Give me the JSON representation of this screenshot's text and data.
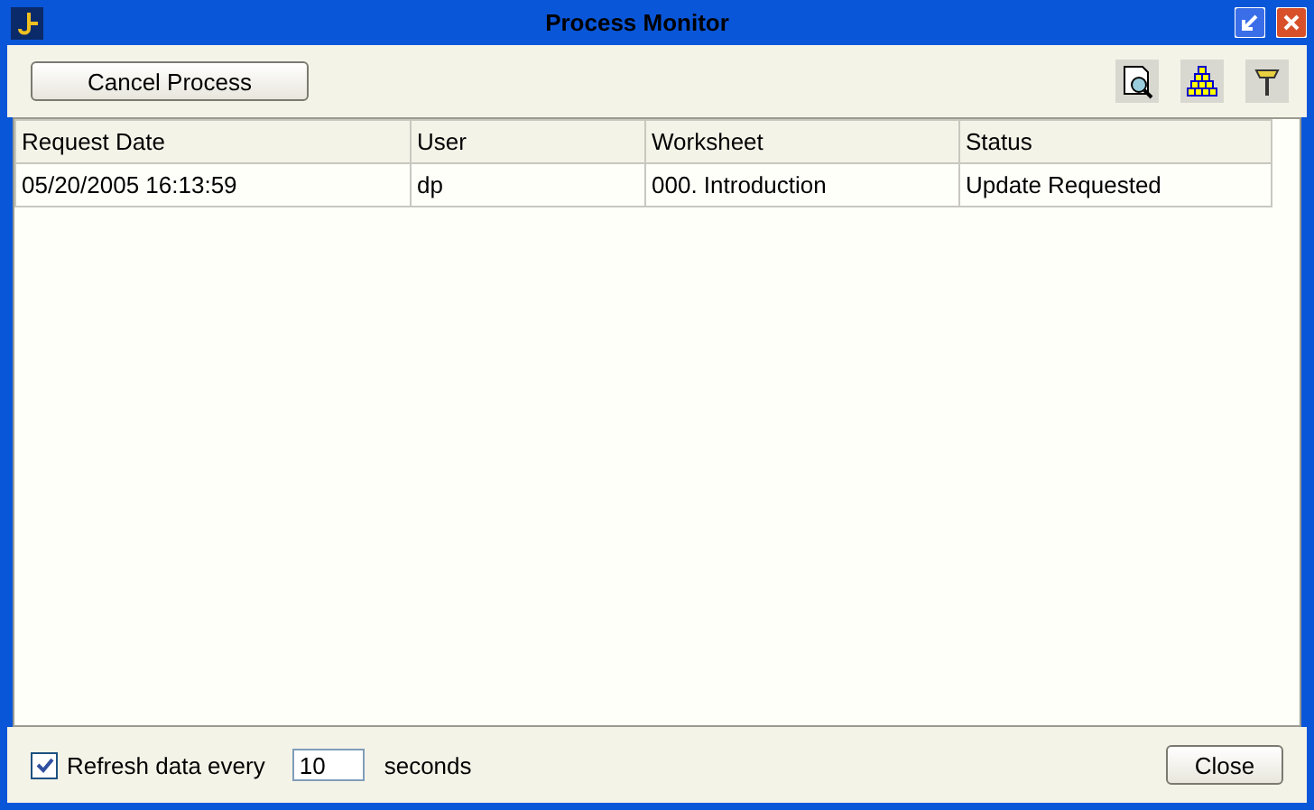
{
  "window": {
    "title": "Process Monitor"
  },
  "toolbar": {
    "cancel_button": "Cancel Process"
  },
  "table": {
    "columns": [
      "Request Date",
      "User",
      "Worksheet",
      "Status"
    ],
    "rows": [
      [
        "05/20/2005 16:13:59",
        "dp",
        "000. Introduction",
        "Update Requested"
      ]
    ]
  },
  "footer": {
    "refresh_checked": true,
    "refresh_label": "Refresh data every",
    "interval": "10",
    "unit": "seconds",
    "close_button": "Close"
  }
}
